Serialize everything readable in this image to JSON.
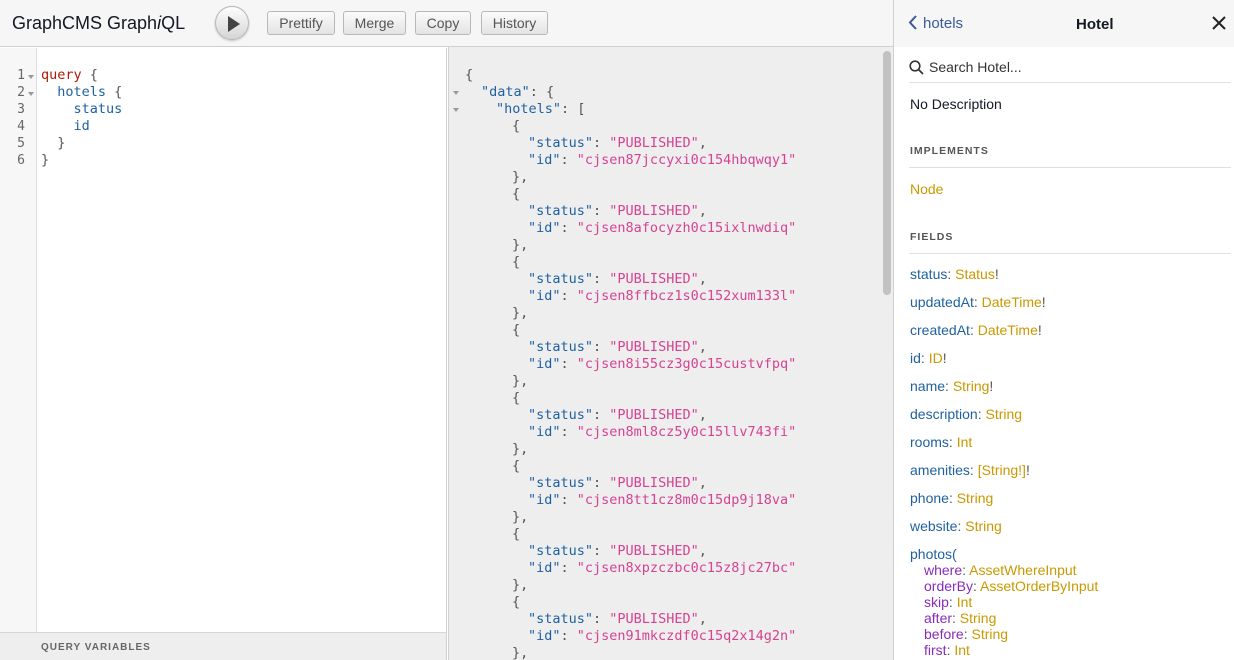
{
  "app": {
    "title_plain": "GraphCMS Graph",
    "title_italic": "i",
    "title_tail": "QL"
  },
  "toolbar": {
    "prettify": "Prettify",
    "merge": "Merge",
    "copy": "Copy",
    "history": "History"
  },
  "query": {
    "line_numbers": [
      "1",
      "2",
      "3",
      "4",
      "5",
      "6"
    ],
    "lines": [
      {
        "kw": "query",
        "rest": " {"
      },
      {
        "field": "  hotels",
        "rest": " {"
      },
      {
        "field": "    status",
        "rest": ""
      },
      {
        "field": "    id",
        "rest": ""
      },
      {
        "field": "",
        "rest": "  }"
      },
      {
        "field": "",
        "rest": "}"
      }
    ],
    "variables_label": "QUERY VARIABLES"
  },
  "result": {
    "open_brace": "{",
    "data_key": "\"data\"",
    "hotels_key": "\"hotels\"",
    "status_key": "\"status\"",
    "id_key": "\"id\"",
    "items": [
      {
        "status": "\"PUBLISHED\"",
        "id": "\"cjsen87jccyxi0c154hbqwqy1\""
      },
      {
        "status": "\"PUBLISHED\"",
        "id": "\"cjsen8afocyzh0c15ixlnwdiq\""
      },
      {
        "status": "\"PUBLISHED\"",
        "id": "\"cjsen8ffbcz1s0c152xum133l\""
      },
      {
        "status": "\"PUBLISHED\"",
        "id": "\"cjsen8i55cz3g0c15custvfpq\""
      },
      {
        "status": "\"PUBLISHED\"",
        "id": "\"cjsen8ml8cz5y0c15llv743fi\""
      },
      {
        "status": "\"PUBLISHED\"",
        "id": "\"cjsen8tt1cz8m0c15dp9j18va\""
      },
      {
        "status": "\"PUBLISHED\"",
        "id": "\"cjsen8xpzczbc0c15z8jc27bc\""
      },
      {
        "status": "\"PUBLISHED\"",
        "id": "\"cjsen91mkczdf0c15q2x14g2n\""
      }
    ]
  },
  "docs": {
    "back_label": "hotels",
    "title": "Hotel",
    "search_placeholder": "Search Hotel...",
    "description": "No Description",
    "implements_label": "IMPLEMENTS",
    "implements": "Node",
    "fields_label": "FIELDS",
    "fields": [
      {
        "name": "status",
        "type": "Status",
        "bang": "!"
      },
      {
        "name": "updatedAt",
        "type": "DateTime",
        "bang": "!"
      },
      {
        "name": "createdAt",
        "type": "DateTime",
        "bang": "!"
      },
      {
        "name": "id",
        "type": "ID",
        "bang": "!"
      },
      {
        "name": "name",
        "type": "String",
        "bang": "!"
      },
      {
        "name": "description",
        "type": "String",
        "bang": ""
      },
      {
        "name": "rooms",
        "type": "Int",
        "bang": ""
      },
      {
        "name": "amenities",
        "type": "[String!]",
        "bang": "!"
      },
      {
        "name": "phone",
        "type": "String",
        "bang": ""
      },
      {
        "name": "website",
        "type": "String",
        "bang": ""
      }
    ],
    "photos_field": "photos(",
    "photos_args": [
      {
        "name": "where",
        "type": "AssetWhereInput"
      },
      {
        "name": "orderBy",
        "type": "AssetOrderByInput"
      },
      {
        "name": "skip",
        "type": "Int"
      },
      {
        "name": "after",
        "type": "String"
      },
      {
        "name": "before",
        "type": "String"
      },
      {
        "name": "first",
        "type": "Int"
      }
    ]
  }
}
